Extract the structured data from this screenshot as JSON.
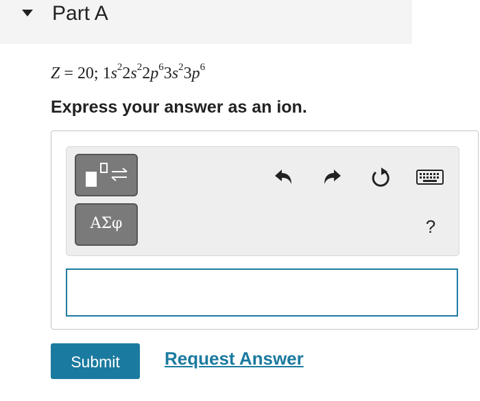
{
  "part": {
    "title": "Part A",
    "collapse_icon": "caret-down-icon"
  },
  "question": {
    "z_label": "Z",
    "equals": " = ",
    "z_value": "20",
    "separator": "; ",
    "config": [
      {
        "shell": "1",
        "orbital": "s",
        "electrons": "2"
      },
      {
        "shell": "2",
        "orbital": "s",
        "electrons": "2"
      },
      {
        "shell": "2",
        "orbital": "p",
        "electrons": "6"
      },
      {
        "shell": "3",
        "orbital": "s",
        "electrons": "2"
      },
      {
        "shell": "3",
        "orbital": "p",
        "electrons": "6"
      }
    ]
  },
  "instruction": "Express your answer as an ion.",
  "toolbar": {
    "templates_icon": "templates-icon",
    "symbols_label": "ΑΣφ",
    "undo_icon": "undo-icon",
    "redo_icon": "redo-icon",
    "reset_icon": "reset-icon",
    "keyboard_icon": "keyboard-icon",
    "help_label": "?"
  },
  "answer": {
    "value": "",
    "placeholder": ""
  },
  "actions": {
    "submit_label": "Submit",
    "request_answer_label": "Request Answer"
  },
  "colors": {
    "accent": "#1b7a9f",
    "header_bg": "#f4f4f4",
    "toolbar_bg": "#eeeeee",
    "tool_button_bg": "#7a7a7a"
  }
}
